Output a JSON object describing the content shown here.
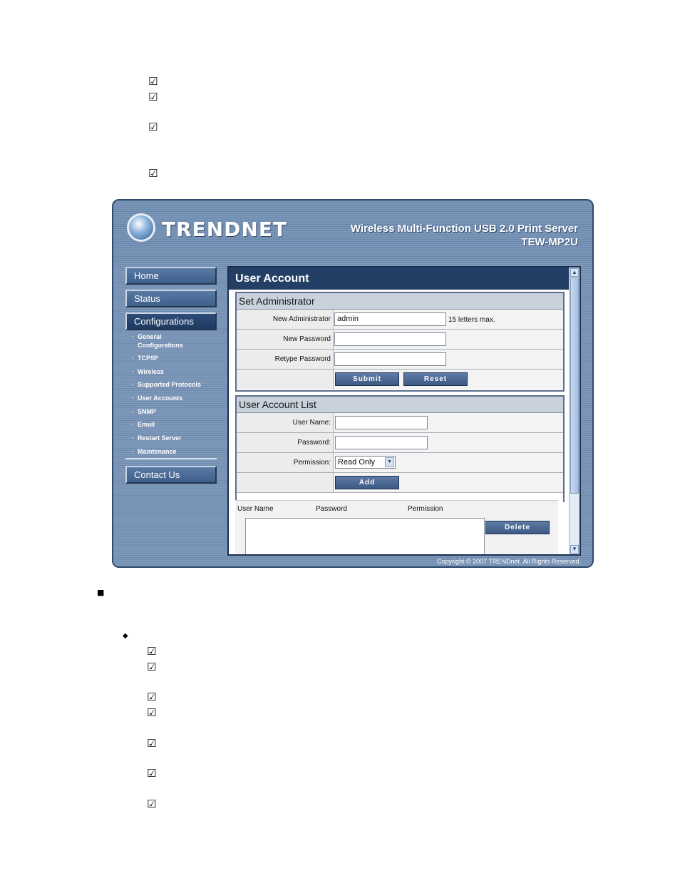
{
  "document": {
    "check_glyph": "☑",
    "square_glyph": "■",
    "diamond_glyph": "◆"
  },
  "device_ui": {
    "logo_text": "TRENDNET",
    "product_name": "Wireless Multi-Function USB 2.0 Print Server",
    "model": "TEW-MP2U",
    "nav": {
      "home": "Home",
      "status": "Status",
      "configurations": "Configurations",
      "sub_items": [
        "General Configurations",
        "TCP/IP",
        "Wireless",
        "Supported Protocols",
        "User Accounts",
        "SNMP",
        "Email",
        "Restart Server",
        "Maintenance"
      ],
      "contact_us": "Contact Us"
    },
    "page_title": "User Account",
    "set_admin": {
      "heading": "Set Administrator",
      "new_admin_label": "New Administrator",
      "new_admin_value": "admin",
      "max_hint": "15 letters max.",
      "new_password_label": "New Password",
      "retype_password_label": "Retype Password",
      "submit_label": "Submit",
      "reset_label": "Reset"
    },
    "user_list": {
      "heading": "User Account List",
      "user_name_label": "User Name:",
      "password_label": "Password:",
      "permission_label": "Permission:",
      "permission_value": "Read Only",
      "add_label": "Add",
      "columns": [
        "User Name",
        "Password",
        "Permission"
      ],
      "delete_label": "Delete"
    },
    "copyright": "Copyright © 2007 TRENDnet. All Rights Reserved."
  }
}
